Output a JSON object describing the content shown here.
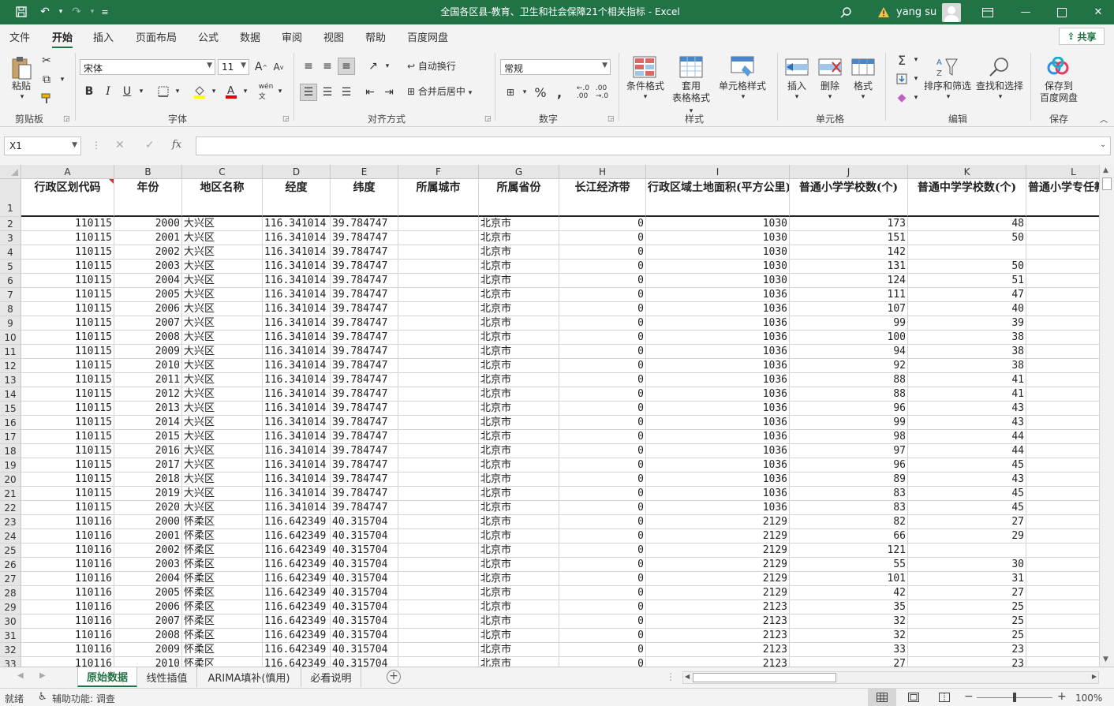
{
  "window": {
    "title": "全国各区县-教育、卫生和社会保障21个相关指标  -  Excel",
    "user": "yang su"
  },
  "menu": {
    "tabs": [
      "文件",
      "开始",
      "插入",
      "页面布局",
      "公式",
      "数据",
      "审阅",
      "视图",
      "帮助",
      "百度网盘"
    ],
    "active": "开始",
    "share": "共享"
  },
  "ribbon": {
    "clipboard": {
      "label": "剪贴板",
      "paste": "粘贴"
    },
    "font": {
      "label": "字体",
      "font_name": "宋体",
      "font_size": "11",
      "bold": "B",
      "italic": "I",
      "underline": "U"
    },
    "alignment": {
      "label": "对齐方式",
      "wrap": "自动换行",
      "merge": "合并后居中"
    },
    "number": {
      "label": "数字",
      "format": "常规"
    },
    "styles": {
      "label": "样式",
      "conditional": "条件格式",
      "table_fmt_1": "套用",
      "table_fmt_2": "表格格式",
      "cell_styles": "单元格样式"
    },
    "cells": {
      "label": "单元格",
      "insert": "插入",
      "delete": "删除",
      "format": "格式"
    },
    "editing": {
      "label": "编辑",
      "sort": "排序和筛选",
      "find": "查找和选择"
    },
    "save": {
      "label": "保存",
      "btn_1": "保存到",
      "btn_2": "百度网盘"
    }
  },
  "formula_bar": {
    "name_box": "X1",
    "formula": ""
  },
  "columns": [
    "A",
    "B",
    "C",
    "D",
    "E",
    "F",
    "G",
    "H",
    "I",
    "J",
    "K",
    "L"
  ],
  "header_row": [
    "行政区划代码",
    "年份",
    "地区名称",
    "经度",
    "纬度",
    "所属城市",
    "所属省份",
    "长江经济带",
    "行政区域土地面积(平方公里)",
    "普通小学学校数(个)",
    "普通中学学校数(个)",
    "普通小学专任教师数"
  ],
  "rows": [
    [
      "110115",
      "2000",
      "大兴区",
      "116.341014",
      "39.784747",
      "",
      "北京市",
      "0",
      "1030",
      "173",
      "48"
    ],
    [
      "110115",
      "2001",
      "大兴区",
      "116.341014",
      "39.784747",
      "",
      "北京市",
      "0",
      "1030",
      "151",
      "50"
    ],
    [
      "110115",
      "2002",
      "大兴区",
      "116.341014",
      "39.784747",
      "",
      "北京市",
      "0",
      "1030",
      "142",
      ""
    ],
    [
      "110115",
      "2003",
      "大兴区",
      "116.341014",
      "39.784747",
      "",
      "北京市",
      "0",
      "1030",
      "131",
      "50"
    ],
    [
      "110115",
      "2004",
      "大兴区",
      "116.341014",
      "39.784747",
      "",
      "北京市",
      "0",
      "1030",
      "124",
      "51"
    ],
    [
      "110115",
      "2005",
      "大兴区",
      "116.341014",
      "39.784747",
      "",
      "北京市",
      "0",
      "1036",
      "111",
      "47"
    ],
    [
      "110115",
      "2006",
      "大兴区",
      "116.341014",
      "39.784747",
      "",
      "北京市",
      "0",
      "1036",
      "107",
      "40"
    ],
    [
      "110115",
      "2007",
      "大兴区",
      "116.341014",
      "39.784747",
      "",
      "北京市",
      "0",
      "1036",
      "99",
      "39"
    ],
    [
      "110115",
      "2008",
      "大兴区",
      "116.341014",
      "39.784747",
      "",
      "北京市",
      "0",
      "1036",
      "100",
      "38"
    ],
    [
      "110115",
      "2009",
      "大兴区",
      "116.341014",
      "39.784747",
      "",
      "北京市",
      "0",
      "1036",
      "94",
      "38"
    ],
    [
      "110115",
      "2010",
      "大兴区",
      "116.341014",
      "39.784747",
      "",
      "北京市",
      "0",
      "1036",
      "92",
      "38"
    ],
    [
      "110115",
      "2011",
      "大兴区",
      "116.341014",
      "39.784747",
      "",
      "北京市",
      "0",
      "1036",
      "88",
      "41"
    ],
    [
      "110115",
      "2012",
      "大兴区",
      "116.341014",
      "39.784747",
      "",
      "北京市",
      "0",
      "1036",
      "88",
      "41"
    ],
    [
      "110115",
      "2013",
      "大兴区",
      "116.341014",
      "39.784747",
      "",
      "北京市",
      "0",
      "1036",
      "96",
      "43"
    ],
    [
      "110115",
      "2014",
      "大兴区",
      "116.341014",
      "39.784747",
      "",
      "北京市",
      "0",
      "1036",
      "99",
      "43"
    ],
    [
      "110115",
      "2015",
      "大兴区",
      "116.341014",
      "39.784747",
      "",
      "北京市",
      "0",
      "1036",
      "98",
      "44"
    ],
    [
      "110115",
      "2016",
      "大兴区",
      "116.341014",
      "39.784747",
      "",
      "北京市",
      "0",
      "1036",
      "97",
      "44"
    ],
    [
      "110115",
      "2017",
      "大兴区",
      "116.341014",
      "39.784747",
      "",
      "北京市",
      "0",
      "1036",
      "96",
      "45"
    ],
    [
      "110115",
      "2018",
      "大兴区",
      "116.341014",
      "39.784747",
      "",
      "北京市",
      "0",
      "1036",
      "89",
      "43"
    ],
    [
      "110115",
      "2019",
      "大兴区",
      "116.341014",
      "39.784747",
      "",
      "北京市",
      "0",
      "1036",
      "83",
      "45"
    ],
    [
      "110115",
      "2020",
      "大兴区",
      "116.341014",
      "39.784747",
      "",
      "北京市",
      "0",
      "1036",
      "83",
      "45"
    ],
    [
      "110116",
      "2000",
      "怀柔区",
      "116.642349",
      "40.315704",
      "",
      "北京市",
      "0",
      "2129",
      "82",
      "27"
    ],
    [
      "110116",
      "2001",
      "怀柔区",
      "116.642349",
      "40.315704",
      "",
      "北京市",
      "0",
      "2129",
      "66",
      "29"
    ],
    [
      "110116",
      "2002",
      "怀柔区",
      "116.642349",
      "40.315704",
      "",
      "北京市",
      "0",
      "2129",
      "121",
      ""
    ],
    [
      "110116",
      "2003",
      "怀柔区",
      "116.642349",
      "40.315704",
      "",
      "北京市",
      "0",
      "2129",
      "55",
      "30"
    ],
    [
      "110116",
      "2004",
      "怀柔区",
      "116.642349",
      "40.315704",
      "",
      "北京市",
      "0",
      "2129",
      "101",
      "31"
    ],
    [
      "110116",
      "2005",
      "怀柔区",
      "116.642349",
      "40.315704",
      "",
      "北京市",
      "0",
      "2129",
      "42",
      "27"
    ],
    [
      "110116",
      "2006",
      "怀柔区",
      "116.642349",
      "40.315704",
      "",
      "北京市",
      "0",
      "2123",
      "35",
      "25"
    ],
    [
      "110116",
      "2007",
      "怀柔区",
      "116.642349",
      "40.315704",
      "",
      "北京市",
      "0",
      "2123",
      "32",
      "25"
    ],
    [
      "110116",
      "2008",
      "怀柔区",
      "116.642349",
      "40.315704",
      "",
      "北京市",
      "0",
      "2123",
      "32",
      "25"
    ],
    [
      "110116",
      "2009",
      "怀柔区",
      "116.642349",
      "40.315704",
      "",
      "北京市",
      "0",
      "2123",
      "33",
      "23"
    ],
    [
      "110116",
      "2010",
      "怀柔区",
      "116.642349",
      "40.315704",
      "",
      "北京市",
      "0",
      "2123",
      "27",
      "23"
    ]
  ],
  "sheet_tabs": [
    "原始数据",
    "线性插值",
    "ARIMA填补(慎用)",
    "必看说明"
  ],
  "active_sheet": "原始数据",
  "status": {
    "ready": "就绪",
    "accessibility": "辅助功能: 调查",
    "zoom": "100%"
  }
}
